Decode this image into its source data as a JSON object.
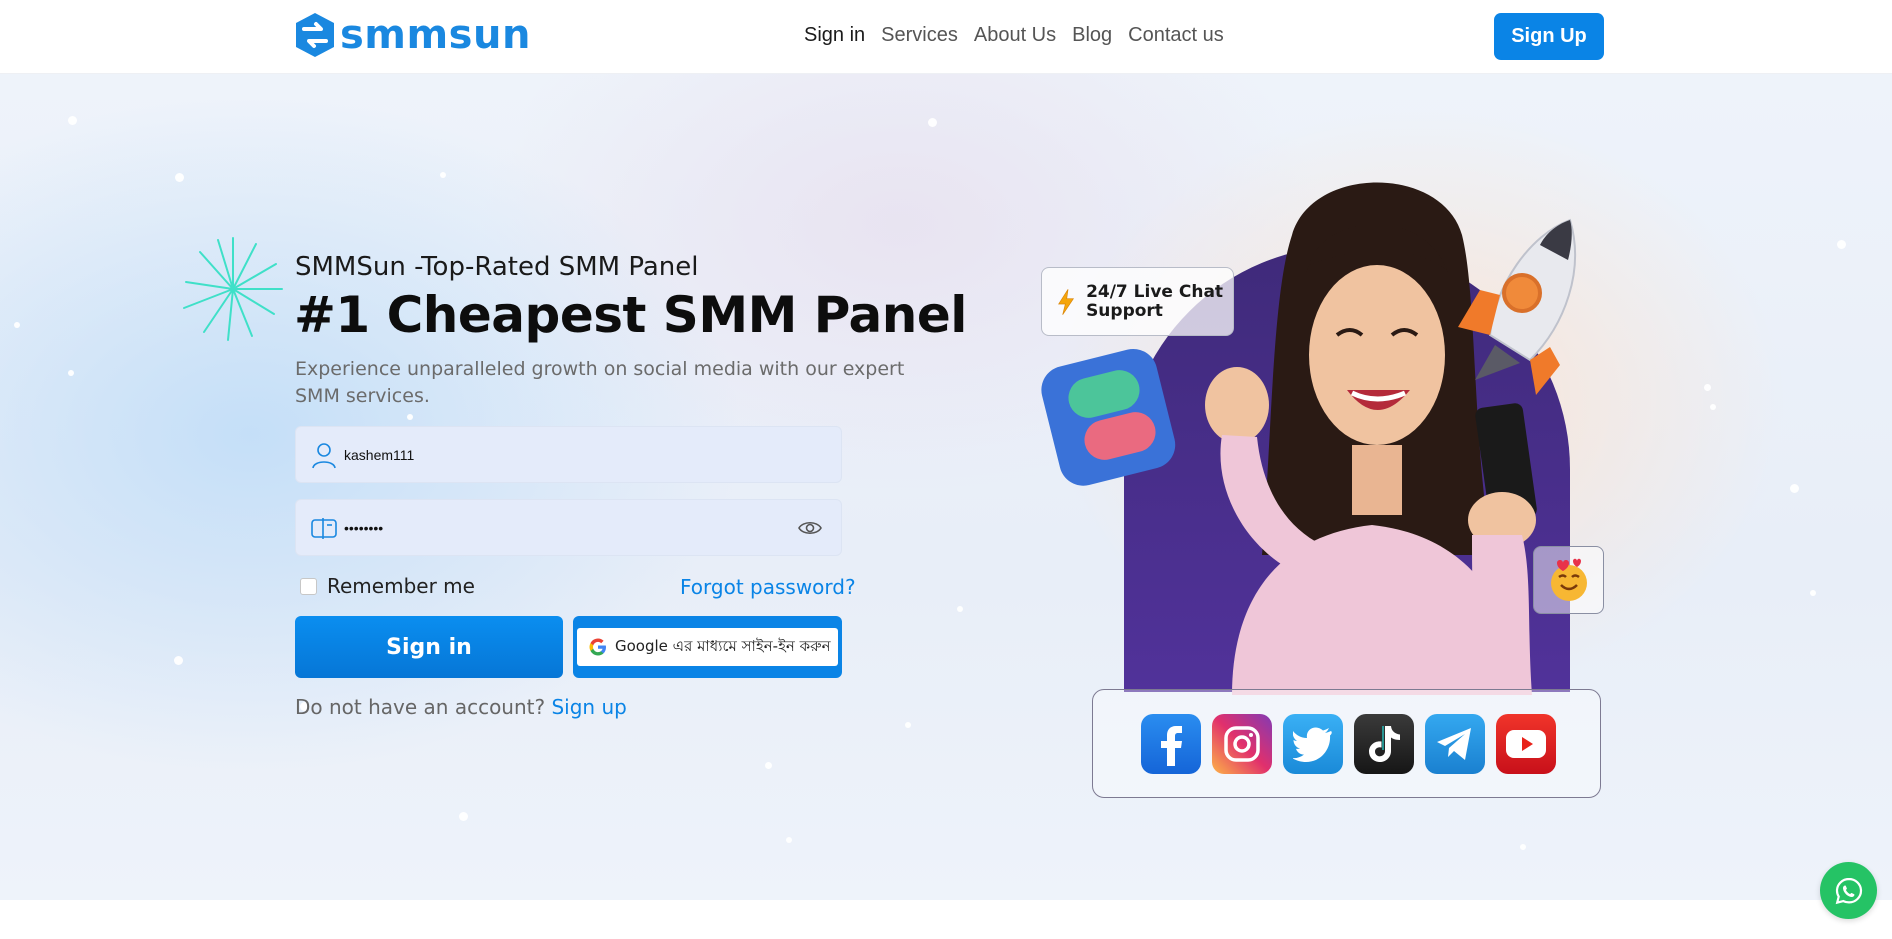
{
  "header": {
    "logo_text": "smmsun",
    "nav": [
      {
        "label": "Sign in",
        "active": true
      },
      {
        "label": "Services"
      },
      {
        "label": "About Us"
      },
      {
        "label": "Blog"
      },
      {
        "label": "Contact us"
      }
    ],
    "signup_label": "Sign Up"
  },
  "hero": {
    "subtitle": "SMMSun -Top-Rated SMM Panel",
    "title": "#1 Cheapest SMM Panel",
    "description": "Experience unparalleled growth on social media with our expert SMM services."
  },
  "login": {
    "username_value": "kashem111",
    "password_value": "••••••••",
    "remember_label": "Remember me",
    "forgot_label": "Forgot password?",
    "signin_label": "Sign in",
    "google_label": "Google এর মাধ্যমে সাইন-ইন করুন",
    "no_account_text": "Do not have an account?",
    "signup_link": "Sign up"
  },
  "illustration": {
    "chat_support": "24/7 Live Chat Support",
    "social_icons": [
      "facebook-icon",
      "instagram-icon",
      "twitter-icon",
      "tiktok-icon",
      "telegram-icon",
      "youtube-icon"
    ]
  },
  "colors": {
    "brand": "#1a88e0",
    "button": "#0a84e6",
    "whatsapp": "#25c365"
  }
}
